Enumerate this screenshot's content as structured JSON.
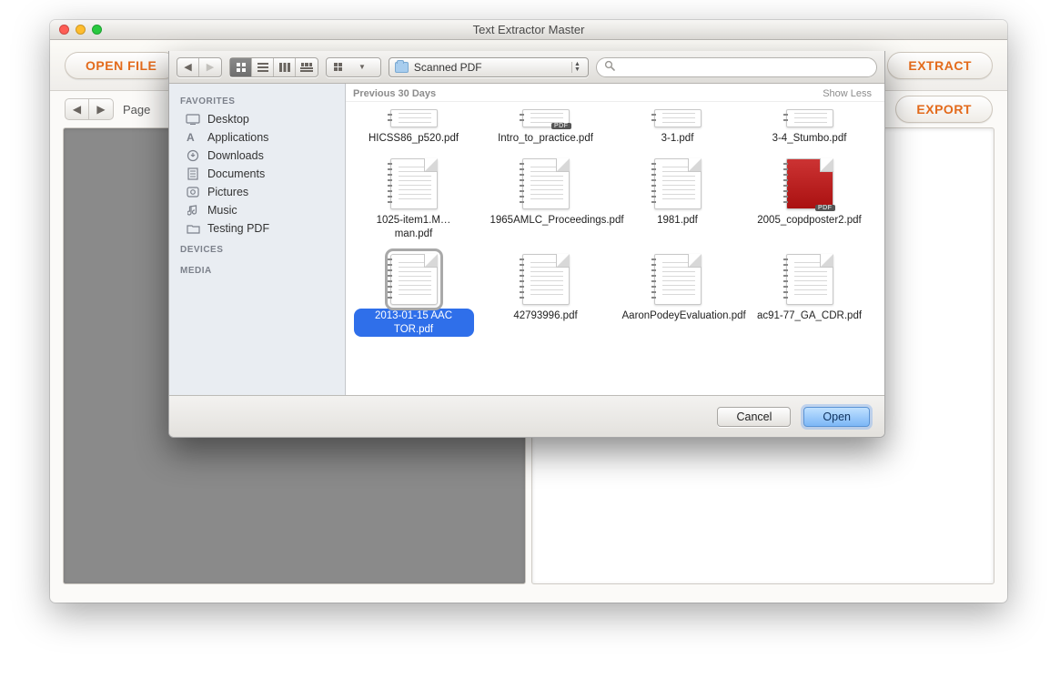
{
  "window": {
    "title": "Text Extractor Master"
  },
  "mainToolbar": {
    "openFile": "OPEN FILE",
    "extract": "EXTRACT",
    "export": "EXPORT"
  },
  "subbar": {
    "pageLabel": "Page"
  },
  "openSheet": {
    "pathPopup": "Scanned PDF",
    "searchPlaceholder": "",
    "sidebar": {
      "section1": "FAVORITES",
      "items": [
        {
          "label": "Desktop",
          "icon": "desktop"
        },
        {
          "label": "Applications",
          "icon": "apps"
        },
        {
          "label": "Downloads",
          "icon": "downloads"
        },
        {
          "label": "Documents",
          "icon": "documents"
        },
        {
          "label": "Pictures",
          "icon": "pictures"
        },
        {
          "label": "Music",
          "icon": "music"
        },
        {
          "label": "Testing PDF",
          "icon": "folder"
        }
      ],
      "section2": "DEVICES",
      "section3": "MEDIA"
    },
    "grid": {
      "groupHeader": "Previous 30 Days",
      "showLess": "Show Less",
      "files": [
        {
          "name": "HICSS86_p520.pdf",
          "top": true
        },
        {
          "name": "Intro_to_practice.pdf",
          "top": true,
          "badge": "PDF"
        },
        {
          "name": "3-1.pdf",
          "top": true
        },
        {
          "name": "3-4_Stumbo.pdf",
          "top": true
        },
        {
          "name": "1025-item1.M…man.pdf"
        },
        {
          "name": "1965AMLC_Proceedings.pdf"
        },
        {
          "name": "1981.pdf"
        },
        {
          "name": "2005_copdposter2.pdf",
          "poster": true,
          "badge": "PDF"
        },
        {
          "name": "2013-01-15 AAC TOR.pdf",
          "selected": true
        },
        {
          "name": "42793996.pdf"
        },
        {
          "name": "AaronPodeyEvaluation.pdf"
        },
        {
          "name": "ac91-77_GA_CDR.pdf"
        }
      ]
    },
    "buttons": {
      "cancel": "Cancel",
      "open": "Open"
    }
  }
}
